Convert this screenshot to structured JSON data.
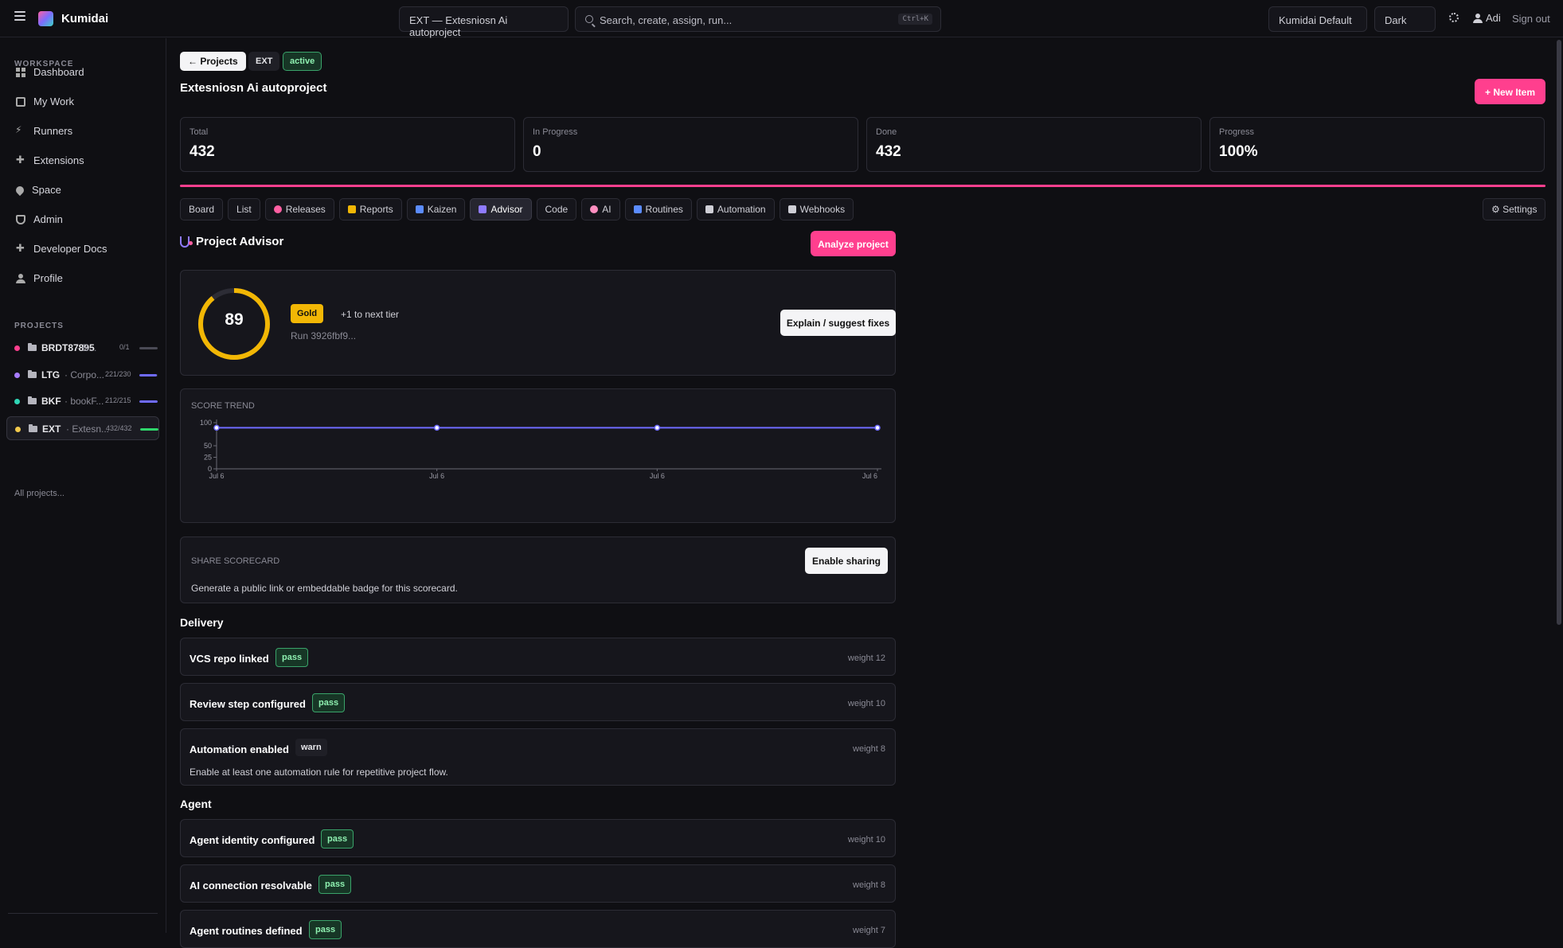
{
  "header": {
    "brand": "Kumidai",
    "project_selector": "EXT — Extesniosn Ai autoproject",
    "search_placeholder": "Search, create, assign, run...",
    "search_shortcut": "Ctrl+K",
    "theme_select": "Kumidai Default",
    "mode_select": "Dark",
    "user_name": "Adi",
    "sign_out": "Sign out"
  },
  "sidebar": {
    "workspace_heading": "WORKSPACE",
    "nav": [
      {
        "label": "Dashboard",
        "icon": "grid-icon"
      },
      {
        "label": "My Work",
        "icon": "document-icon"
      },
      {
        "label": "Runners",
        "icon": "bolt-icon"
      },
      {
        "label": "Extensions",
        "icon": "puzzle-icon"
      },
      {
        "label": "Space",
        "icon": "pin-icon"
      },
      {
        "label": "Admin",
        "icon": "shield-icon"
      },
      {
        "label": "Developer Docs",
        "icon": "puzzle-icon"
      },
      {
        "label": "Profile",
        "icon": "user-icon"
      }
    ],
    "projects_heading": "PROJECTS",
    "projects": [
      {
        "key": "BRDT87895",
        "name": "· B...",
        "count": "0/1",
        "color": "#ff3f8e",
        "progress": 0,
        "bar_color": "#4a4a55"
      },
      {
        "key": "LTG",
        "name": "· Corpo...",
        "count": "221/230",
        "color": "#a77bff",
        "progress": 0.96,
        "bar_color": "#6f6bff"
      },
      {
        "key": "BKF",
        "name": "· bookF...",
        "count": "212/215",
        "color": "#2fd6b6",
        "progress": 0.99,
        "bar_color": "#6f6bff"
      },
      {
        "key": "EXT",
        "name": "· Extesn...",
        "count": "432/432",
        "color": "#f2c94c",
        "progress": 1.0,
        "bar_color": "#2fd66b"
      }
    ],
    "all_projects": "All projects..."
  },
  "project": {
    "back_label": "← Projects",
    "key": "EXT",
    "status": "active",
    "title": "Extesniosn Ai autoproject",
    "new_item_label": "+ New Item",
    "stats": [
      {
        "label": "Total",
        "value": "432"
      },
      {
        "label": "In Progress",
        "value": "0"
      },
      {
        "label": "Done",
        "value": "432"
      },
      {
        "label": "Progress",
        "value": "100%"
      }
    ],
    "progress_fraction": 1.0
  },
  "tabs": [
    {
      "label": "Board",
      "icon": ""
    },
    {
      "label": "List",
      "icon": ""
    },
    {
      "label": "Releases",
      "icon": "target-icon"
    },
    {
      "label": "Reports",
      "icon": "chart-icon"
    },
    {
      "label": "Kaizen",
      "icon": "calendar-icon"
    },
    {
      "label": "Advisor",
      "icon": "stethoscope-icon",
      "active": true
    },
    {
      "label": "Code",
      "icon": ""
    },
    {
      "label": "AI",
      "icon": "brain-icon"
    },
    {
      "label": "Routines",
      "icon": "calendar-icon"
    },
    {
      "label": "Automation",
      "icon": "gear-icon"
    },
    {
      "label": "Webhooks",
      "icon": "link-icon"
    }
  ],
  "settings_tab": "⚙ Settings",
  "advisor": {
    "title": "Project Advisor",
    "analyze_label": "Analyze project",
    "score": 89,
    "score_max": 100,
    "tier": "Gold",
    "next_tier": "+1 to next tier",
    "run_id": "Run 3926fbf9...",
    "explain_label": "Explain / suggest fixes",
    "ring_color": "#f2b705",
    "trend_label": "SCORE TREND",
    "share_label": "SHARE SCORECARD",
    "share_desc": "Generate a public link or embeddable badge for this scorecard.",
    "share_button": "Enable sharing"
  },
  "chart_data": {
    "type": "line",
    "title": "SCORE TREND",
    "x": [
      "Jul 6",
      "Jul 6",
      "Jul 6",
      "Jul 6"
    ],
    "series": [
      {
        "values": [
          89,
          89,
          89,
          89
        ]
      }
    ],
    "yticks": [
      0,
      25,
      50,
      100
    ],
    "ylim": [
      0,
      100
    ],
    "line_color": "#6f6bff",
    "grid": false
  },
  "sections": [
    {
      "title": "Delivery",
      "checks": [
        {
          "name": "VCS repo linked",
          "status": "pass",
          "weight": "weight 12",
          "desc": ""
        },
        {
          "name": "Review step configured",
          "status": "pass",
          "weight": "weight 10",
          "desc": ""
        },
        {
          "name": "Automation enabled",
          "status": "warn",
          "weight": "weight 8",
          "desc": "Enable at least one automation rule for repetitive project flow."
        }
      ]
    },
    {
      "title": "Agent",
      "checks": [
        {
          "name": "Agent identity configured",
          "status": "pass",
          "weight": "weight 10",
          "desc": ""
        },
        {
          "name": "AI connection resolvable",
          "status": "pass",
          "weight": "weight 8",
          "desc": ""
        },
        {
          "name": "Agent routines defined",
          "status": "pass",
          "weight": "weight 7",
          "desc": ""
        }
      ]
    }
  ]
}
